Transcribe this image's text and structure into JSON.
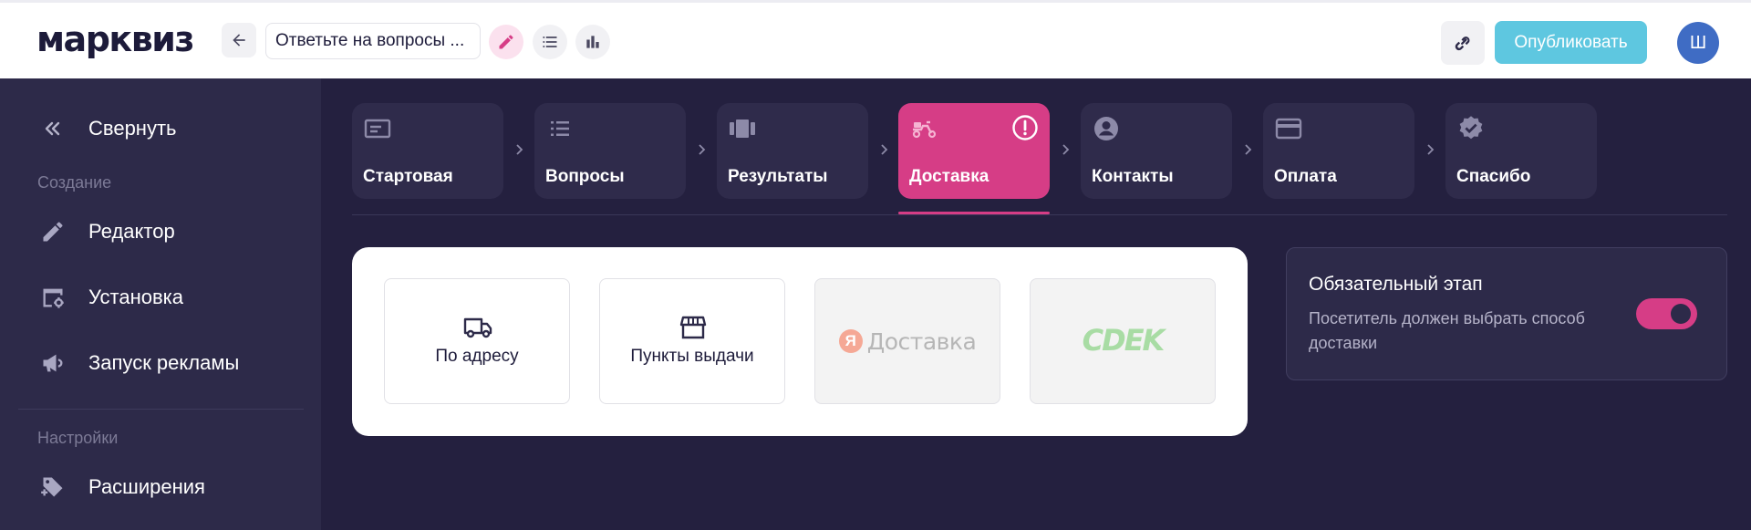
{
  "header": {
    "logo": "марквиз",
    "quiz_title": "Ответьте на вопросы ...",
    "publish_label": "Опубликовать",
    "avatar_letter": "Ш"
  },
  "sidebar": {
    "collapse_label": "Свернуть",
    "section_create": "Создание",
    "items": [
      {
        "label": "Редактор",
        "icon": "pencil-icon"
      },
      {
        "label": "Установка",
        "icon": "install-settings-icon"
      },
      {
        "label": "Запуск рекламы",
        "icon": "megaphone-icon"
      }
    ],
    "section_settings": "Настройки",
    "extensions_label": "Расширения"
  },
  "steps": [
    {
      "label": "Стартовая",
      "icon": "start-page-icon"
    },
    {
      "label": "Вопросы",
      "icon": "list-icon"
    },
    {
      "label": "Результаты",
      "icon": "results-icon"
    },
    {
      "label": "Доставка",
      "icon": "scooter-icon",
      "active": true,
      "warning": true
    },
    {
      "label": "Контакты",
      "icon": "account-icon"
    },
    {
      "label": "Оплата",
      "icon": "credit-card-icon"
    },
    {
      "label": "Спасибо",
      "icon": "verified-icon"
    }
  ],
  "delivery": {
    "options": [
      {
        "label": "По адресу",
        "icon": "truck-icon",
        "enabled": true
      },
      {
        "label": "Пункты выдачи",
        "icon": "store-icon",
        "enabled": true
      },
      {
        "label": "Доставка",
        "logo_letter": "Я",
        "enabled": false
      },
      {
        "label": "CDEK",
        "enabled": false
      }
    ]
  },
  "required_step": {
    "title": "Обязательный этап",
    "description": "Посетитель должен выбрать способ доставки",
    "enabled": true
  },
  "colors": {
    "accent": "#d63d86",
    "publish": "#5ec7e0",
    "background": "#24203f",
    "sidebar": "#2d2a49"
  }
}
